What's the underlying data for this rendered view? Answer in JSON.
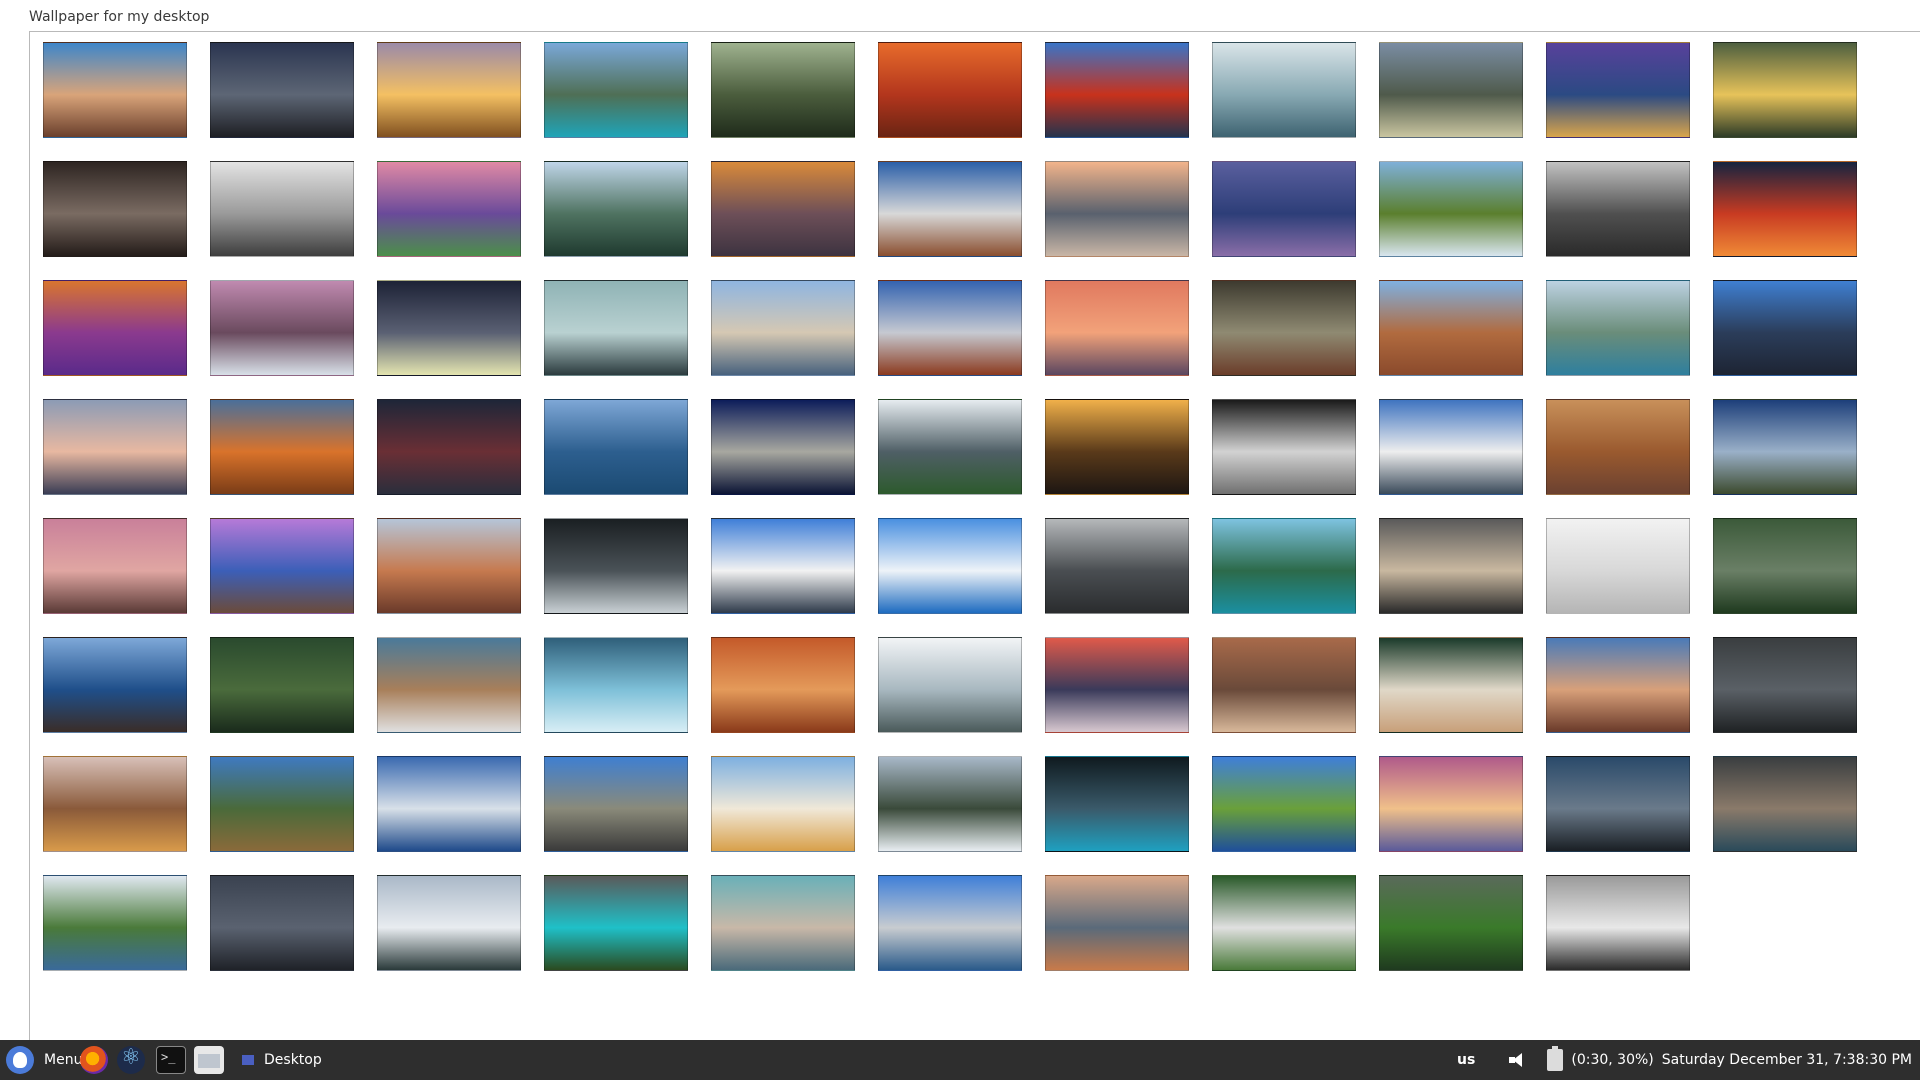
{
  "window": {
    "title": "Wallpaper for my desktop"
  },
  "gallery": {
    "selected_index": 87,
    "thumbnails": [
      {
        "name": "coastal-sunset-rocks",
        "c": [
          "#3f86c9",
          "#d9a47a",
          "#6a3f2c"
        ]
      },
      {
        "name": "night-tree-roots",
        "c": [
          "#2b3550",
          "#5d6675",
          "#1e1f24"
        ]
      },
      {
        "name": "golden-field-sunset",
        "c": [
          "#9b8aa8",
          "#f4c063",
          "#805020"
        ]
      },
      {
        "name": "turquoise-mountain-lake",
        "c": [
          "#7aa8d8",
          "#4f6f55",
          "#1fa4b8"
        ]
      },
      {
        "name": "misty-forest",
        "c": [
          "#9fb28f",
          "#4b5d3d",
          "#1f2b1b"
        ]
      },
      {
        "name": "autumn-red-trees",
        "c": [
          "#e76b2b",
          "#b3361d",
          "#6a2413"
        ]
      },
      {
        "name": "red-autumn-lake",
        "c": [
          "#3a74c7",
          "#c8321c",
          "#24334d"
        ]
      },
      {
        "name": "snowy-pine-lake",
        "c": [
          "#d9e4e8",
          "#88a9b3",
          "#3e6371"
        ]
      },
      {
        "name": "yosemite-valley-mist",
        "c": [
          "#7a8da3",
          "#4f5a4b",
          "#c9c5a0"
        ]
      },
      {
        "name": "city-lights-night",
        "c": [
          "#58419b",
          "#2b4a83",
          "#d9a54b"
        ]
      },
      {
        "name": "sunbeam-mountain-valley",
        "c": [
          "#4e5f3f",
          "#e7c35a",
          "#2d3b27"
        ]
      },
      {
        "name": "lion-portrait-dark",
        "c": [
          "#2e2522",
          "#7a6b62",
          "#241c19"
        ]
      },
      {
        "name": "plane-wreck-bw",
        "c": [
          "#e3e3e3",
          "#9a9a9a",
          "#3e3e3e"
        ]
      },
      {
        "name": "purple-sunset-coast",
        "c": [
          "#e08aa5",
          "#6a4a9a",
          "#4c8f4a"
        ]
      },
      {
        "name": "fjord-sunrays",
        "c": [
          "#bfd5e8",
          "#4f7361",
          "#1f3a2f"
        ]
      },
      {
        "name": "orange-volcano-haze",
        "c": [
          "#d98a3a",
          "#6d4f58",
          "#3d3340"
        ]
      },
      {
        "name": "snowy-peaks-reflection",
        "c": [
          "#2b5fa8",
          "#d8d8d8",
          "#8a4e2f"
        ]
      },
      {
        "name": "city-skyline-sunset",
        "c": [
          "#f2b48b",
          "#59616e",
          "#c9b6a6"
        ]
      },
      {
        "name": "purple-valley-dusk",
        "c": [
          "#5a5f9e",
          "#2d3e78",
          "#8a6ea8"
        ]
      },
      {
        "name": "waterfall-green-cliffs",
        "c": [
          "#7fb0d8",
          "#5b7f2d",
          "#d9e6ef"
        ]
      },
      {
        "name": "rocks-in-sea-bw",
        "c": [
          "#c2c2c2",
          "#505050",
          "#2a2a2a"
        ]
      },
      {
        "name": "red-sky-islands",
        "c": [
          "#16233f",
          "#c83b22",
          "#f08a36"
        ]
      },
      {
        "name": "grand-canyon-purple",
        "c": [
          "#d9752f",
          "#8b3a8e",
          "#5a2a8a"
        ]
      },
      {
        "name": "misty-waterfall-cliffs",
        "c": [
          "#c08ab0",
          "#6a4a5e",
          "#d8e0e8"
        ]
      },
      {
        "name": "vintage-propeller",
        "c": [
          "#1d2236",
          "#5a6073",
          "#e4e5b0"
        ]
      },
      {
        "name": "boat-on-calm-sea",
        "c": [
          "#8fb3b5",
          "#b9d1d1",
          "#2b3b3e"
        ]
      },
      {
        "name": "wide-snowy-mountains",
        "c": [
          "#8fb5e0",
          "#d5c8b3",
          "#47617d"
        ]
      },
      {
        "name": "dramatic-clouds-hills",
        "c": [
          "#3463b0",
          "#c6c9d1",
          "#8b3a1f"
        ]
      },
      {
        "name": "drone-pink-sky",
        "c": [
          "#e0795f",
          "#f2a27a",
          "#5a4660"
        ]
      },
      {
        "name": "storm-clouds-rock",
        "c": [
          "#3d3a2f",
          "#8f8a72",
          "#6b3d2a"
        ]
      },
      {
        "name": "bryce-canyon-hoodoos",
        "c": [
          "#7fb0e0",
          "#b16b3f",
          "#8a4a2c"
        ]
      },
      {
        "name": "glacial-lake-rocks",
        "c": [
          "#bdd2e2",
          "#6a8d7a",
          "#2e7f9e"
        ]
      },
      {
        "name": "futuristic-city-towers",
        "c": [
          "#3f7fd1",
          "#2b3d5a",
          "#1d2433"
        ]
      },
      {
        "name": "pastel-dusk-mountains",
        "c": [
          "#8c9bb5",
          "#e8b8a1",
          "#3a3d55"
        ]
      },
      {
        "name": "orange-grass-lake",
        "c": [
          "#4a6f9a",
          "#d9732b",
          "#7a3c17"
        ]
      },
      {
        "name": "dark-red-mountains",
        "c": [
          "#1e2638",
          "#6a2f35",
          "#2a2e3c"
        ]
      },
      {
        "name": "lake-pier-mountains",
        "c": [
          "#7ea7d6",
          "#2d5f8f",
          "#1b4a72"
        ]
      },
      {
        "name": "el-capitan-night",
        "c": [
          "#0d1d5a",
          "#a8a8a0",
          "#0b1435"
        ]
      },
      {
        "name": "misty-green-mountains",
        "c": [
          "#e6ecf0",
          "#4f5f66",
          "#2d5a2d"
        ]
      },
      {
        "name": "tree-silhouette-sunset",
        "c": [
          "#f0b04a",
          "#5a3a1a",
          "#1d1612"
        ]
      },
      {
        "name": "lunar-surface-lander",
        "c": [
          "#1a1a1a",
          "#d2d2d2",
          "#707070"
        ]
      },
      {
        "name": "snowy-ridge-blue-sky",
        "c": [
          "#3f74c0",
          "#eeeeee",
          "#3a4a5a"
        ]
      },
      {
        "name": "mars-rover-desert",
        "c": [
          "#c8905a",
          "#9a5a2f",
          "#6b4130"
        ]
      },
      {
        "name": "highland-river-night",
        "c": [
          "#1d3f7a",
          "#9ab0c8",
          "#3c4a2e"
        ]
      },
      {
        "name": "pebble-beach-sunset",
        "c": [
          "#c9809a",
          "#e0a6a2",
          "#5a3a36"
        ]
      },
      {
        "name": "wooden-pier-purple",
        "c": [
          "#b67ad8",
          "#3c5fb8",
          "#6b4b3a"
        ]
      },
      {
        "name": "half-dome-sunset",
        "c": [
          "#b5c5d8",
          "#c67a4f",
          "#6a3a2a"
        ]
      },
      {
        "name": "cn-tower-bw",
        "c": [
          "#1a1f22",
          "#4a5257",
          "#c9d0d4"
        ]
      },
      {
        "name": "snowy-alps-sky",
        "c": [
          "#3f7fd8",
          "#f2f2f2",
          "#2e3a4a"
        ]
      },
      {
        "name": "clouds-sea-horizon",
        "c": [
          "#4a90e0",
          "#eef3f8",
          "#1e6bc0"
        ]
      },
      {
        "name": "golden-gate-fog",
        "c": [
          "#b5b8ba",
          "#4a4e52",
          "#2a2c2e"
        ]
      },
      {
        "name": "hot-air-balloon-lake",
        "c": [
          "#7ec3e0",
          "#2c6a4a",
          "#1b8fa0"
        ]
      },
      {
        "name": "roaring-lion-bw",
        "c": [
          "#5a5a5a",
          "#c9b8a0",
          "#2a2a2a"
        ]
      },
      {
        "name": "cable-car-fog",
        "c": [
          "#f2f2f2",
          "#d8d8d8",
          "#b5b5b5"
        ]
      },
      {
        "name": "forest-bridge-aerial",
        "c": [
          "#3c5a3a",
          "#6a7f66",
          "#1f3a1f"
        ]
      },
      {
        "name": "crashing-waves-rocks",
        "c": [
          "#7ea8d8",
          "#1f4f8a",
          "#3a2d28"
        ]
      },
      {
        "name": "dense-pine-forest",
        "c": [
          "#2a4a2e",
          "#4a6b3c",
          "#1a2b1c"
        ]
      },
      {
        "name": "vintage-car-steering",
        "c": [
          "#4a7a9a",
          "#a87f5a",
          "#e0e0e0"
        ]
      },
      {
        "name": "misty-lake-reflection",
        "c": [
          "#2f5f7a",
          "#7ec0d8",
          "#d8eef5"
        ]
      },
      {
        "name": "red-rock-canyon",
        "c": [
          "#c45a2a",
          "#e49a5a",
          "#8a3a1a"
        ]
      },
      {
        "name": "snowy-range-white-sky",
        "c": [
          "#f2f4f6",
          "#a8b8c0",
          "#4a5a5a"
        ]
      },
      {
        "name": "matterhorn-sunset",
        "c": [
          "#e05a4a",
          "#3a3a5a",
          "#d8c8d0"
        ]
      },
      {
        "name": "zion-canyon-walls",
        "c": [
          "#a86a4a",
          "#6a4a3a",
          "#d8b89a"
        ]
      },
      {
        "name": "aerial-beach-waves",
        "c": [
          "#1a3a2a",
          "#e0d8c8",
          "#c8a07a"
        ]
      },
      {
        "name": "coastal-rocks-sunset",
        "c": [
          "#4a7ab8",
          "#d8a07a",
          "#6a3a2a"
        ]
      },
      {
        "name": "dark-city-skyline",
        "c": [
          "#3a3e40",
          "#5a6066",
          "#1f2224"
        ]
      },
      {
        "name": "volcanic-crater-valley",
        "c": [
          "#d8c0b8",
          "#8a5a3a",
          "#d89a4a"
        ]
      },
      {
        "name": "green-headland-sea",
        "c": [
          "#3f7ac0",
          "#4a6a3a",
          "#8a6a3a"
        ]
      },
      {
        "name": "wind-turbine-moon",
        "c": [
          "#3a6ab0",
          "#d8e0e8",
          "#1f4a8a"
        ]
      },
      {
        "name": "mountain-road",
        "c": [
          "#3f7fd0",
          "#8a8a7a",
          "#3a3a3a"
        ]
      },
      {
        "name": "rocket-launch",
        "c": [
          "#7eb0e0",
          "#f0e8d8",
          "#d8a04a"
        ]
      },
      {
        "name": "snowy-road-forest",
        "c": [
          "#a8b8c8",
          "#3a4a3a",
          "#e8eef2"
        ]
      },
      {
        "name": "train-in-snow-night",
        "c": [
          "#0f1a1f",
          "#3a5a6a",
          "#1fa0c0"
        ]
      },
      {
        "name": "alpine-lake-blue",
        "c": [
          "#3f7fd8",
          "#6aa03a",
          "#1f4f9a"
        ]
      },
      {
        "name": "winter-mountain-sunrise",
        "c": [
          "#b05a8a",
          "#f0c08a",
          "#5a5a9a"
        ]
      },
      {
        "name": "giants-causeway-stones",
        "c": [
          "#2a4a6a",
          "#6a7a8a",
          "#1a1f24"
        ]
      },
      {
        "name": "sea-cliffs-dark",
        "c": [
          "#3a3e40",
          "#8a7a6a",
          "#2a4a5a"
        ]
      },
      {
        "name": "green-sea-cliffs",
        "c": [
          "#e0e8f0",
          "#4a7a3a",
          "#3a6a9a"
        ]
      },
      {
        "name": "dark-rocky-shore",
        "c": [
          "#3a4250",
          "#5a6270",
          "#1f2228"
        ]
      },
      {
        "name": "frozen-lake-mountains",
        "c": [
          "#aab8c8",
          "#e8ecf0",
          "#2a3a3a"
        ]
      },
      {
        "name": "turquoise-lake-wildflowers",
        "c": [
          "#5a5a5a",
          "#1fc0c8",
          "#2a4a1f"
        ]
      },
      {
        "name": "mountain-lake-reflection",
        "c": [
          "#6ab0b8",
          "#c8b8a8",
          "#4a6a7a"
        ]
      },
      {
        "name": "snowy-rocks-lake",
        "c": [
          "#3f7fd8",
          "#c8ccd0",
          "#2a5a8a"
        ]
      },
      {
        "name": "pier-sunset-calm",
        "c": [
          "#d8a88a",
          "#5a6a7a",
          "#c87a4a"
        ]
      },
      {
        "name": "green-waterfalls",
        "c": [
          "#2a5a2a",
          "#e0e0e0",
          "#4a7a3a"
        ]
      },
      {
        "name": "green-valley-clouds",
        "c": [
          "#5a6a5a",
          "#3a7a2a",
          "#1f3a1f"
        ]
      },
      {
        "name": "railway-tracks-bw",
        "c": [
          "#9a9a9a",
          "#e8e8e8",
          "#2a2a2a"
        ]
      }
    ]
  },
  "taskbar": {
    "menu_label": "Menu",
    "window_label": "Desktop",
    "keyboard_layout": "us",
    "battery_status": "(0:30, 30%)",
    "clock": "Saturday December 31,  7:38:30 PM"
  }
}
